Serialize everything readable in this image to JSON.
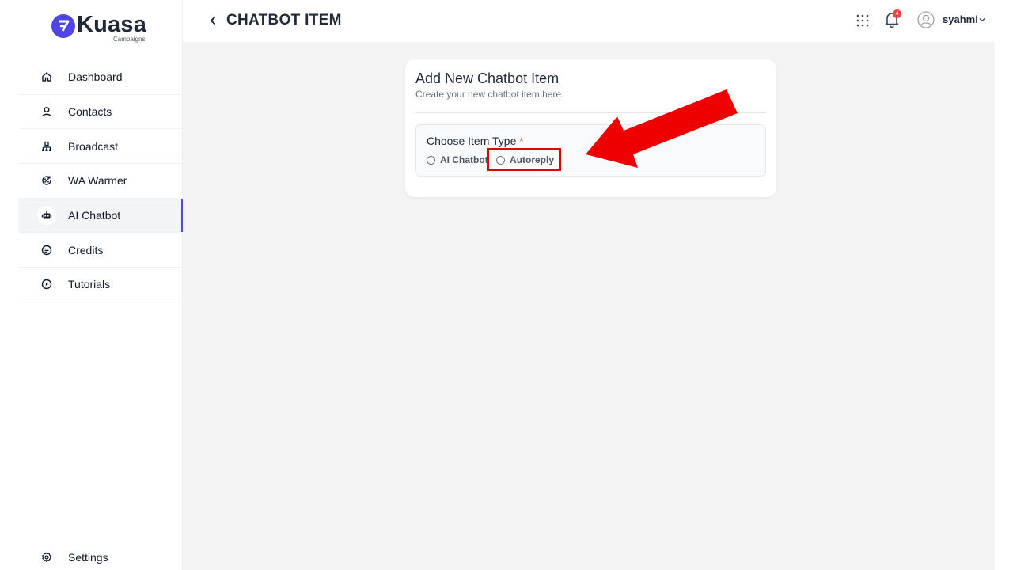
{
  "brand": {
    "name": "Kuasa",
    "sub": "Campaigns",
    "accent": "#4f46e5"
  },
  "sidebar": {
    "items": [
      {
        "label": "Dashboard",
        "icon": "home-icon"
      },
      {
        "label": "Contacts",
        "icon": "user-icon"
      },
      {
        "label": "Broadcast",
        "icon": "broadcast-icon"
      },
      {
        "label": "WA Warmer",
        "icon": "warmer-icon"
      },
      {
        "label": "AI Chatbot",
        "icon": "robot-icon",
        "active": true
      },
      {
        "label": "Credits",
        "icon": "credits-icon"
      },
      {
        "label": "Tutorials",
        "icon": "play-icon"
      }
    ],
    "settings_label": "Settings"
  },
  "header": {
    "title": "CHATBOT ITEM",
    "notification_count": "4",
    "username": "syahmi"
  },
  "card": {
    "title": "Add New Chatbot Item",
    "subtitle": "Create your new chatbot item here.",
    "field_label": "Choose Item Type",
    "required_mark": "*",
    "options": [
      {
        "label": "AI Chatbot",
        "selected": false
      },
      {
        "label": "Autoreply",
        "selected": false
      }
    ]
  },
  "annotation": {
    "highlight_color": "#e00000"
  }
}
